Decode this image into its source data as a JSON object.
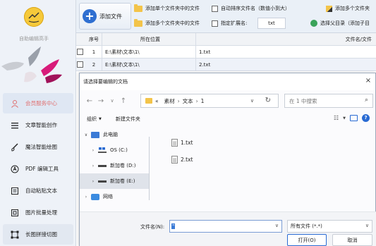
{
  "sidebar": {
    "app_name": "自助编辑高手",
    "items": [
      {
        "label": "会员服务中心",
        "icon": "user-icon"
      },
      {
        "label": "文章智能创作",
        "icon": "list-icon"
      },
      {
        "label": "魔法智能绘图",
        "icon": "brush-icon"
      },
      {
        "label": "PDF 编辑工具",
        "icon": "pdf-icon"
      },
      {
        "label": "自动粘贴文本",
        "icon": "paste-icon"
      },
      {
        "label": "图片批量处理",
        "icon": "image-icon"
      },
      {
        "label": "长图拼接切图",
        "icon": "crop-icon"
      }
    ]
  },
  "toolbar": {
    "add_file": "添加文件",
    "add_single_folder": "添加单个文件夹中的文件",
    "add_multi_folder": "添加多个文件夹中的文件",
    "auto_sort": "自动排序文件名（数值小到大）",
    "specify_ext": "指定扩展名:",
    "ext_value": "txt",
    "add_multi_files": "添加多个文件夹",
    "select_parent": "选择父目录（添加子目"
  },
  "table": {
    "headers": {
      "index": "序号",
      "location": "所在位置",
      "name": "文件名/文件"
    },
    "rows": [
      {
        "index": "1",
        "location": "E:\\素材\\文本\\1\\",
        "name": "1.txt"
      },
      {
        "index": "2",
        "location": "E:\\素材\\文本\\1\\",
        "name": "2.txt"
      }
    ]
  },
  "dialog": {
    "title": "请选择要编辑的文档",
    "close": "×",
    "path": {
      "prefix": "«",
      "parts": [
        "素材",
        "文本",
        "1"
      ]
    },
    "search_placeholder": "在 1 中搜索",
    "organize": "组织",
    "new_folder": "新建文件夹",
    "tree": [
      {
        "label": "此电脑",
        "expanded": true
      },
      {
        "label": "OS (C:)"
      },
      {
        "label": "新加卷 (D:)"
      },
      {
        "label": "新加卷 (E:)",
        "selected": true
      },
      {
        "label": "网络"
      }
    ],
    "files": [
      "1.txt",
      "2.txt"
    ],
    "filename_label": "文件名(N):",
    "filename_value": "\"",
    "filter": "所有文件 (*.*)",
    "open": "打开(O)",
    "cancel": "取消"
  },
  "colors": {
    "accent": "#2a6bd3",
    "member_active": "#e07070",
    "folder": "#f3c44a"
  }
}
